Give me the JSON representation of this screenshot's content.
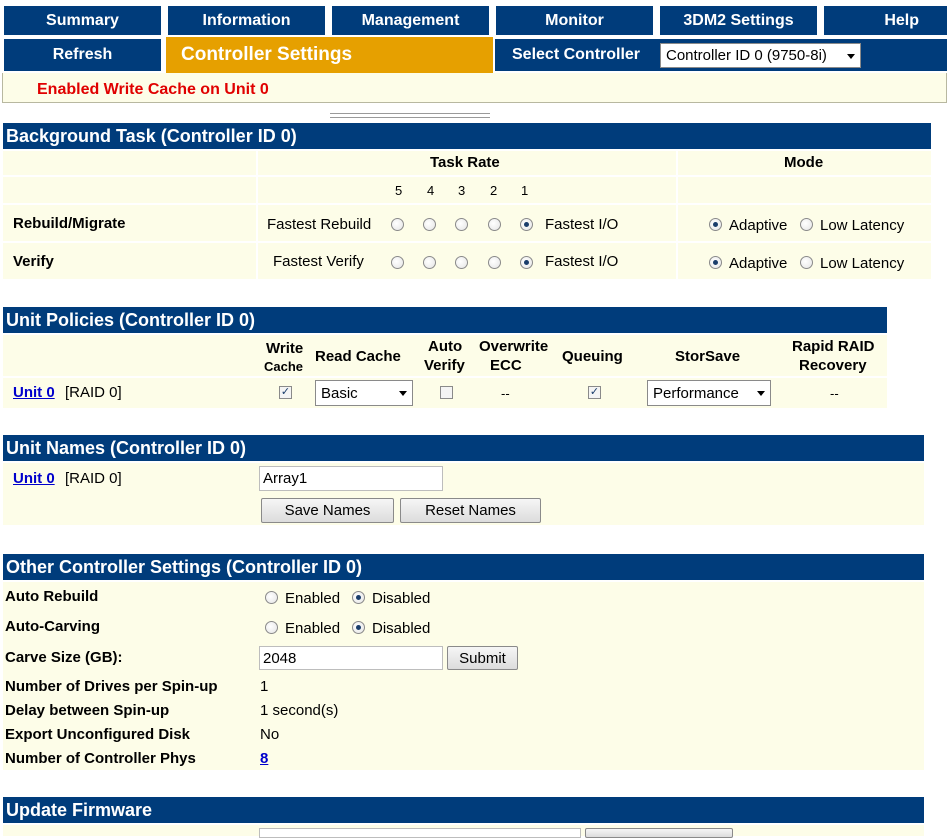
{
  "nav": {
    "summary": "Summary",
    "information": "Information",
    "management": "Management",
    "monitor": "Monitor",
    "settings": "3DM2 Settings",
    "help": "Help",
    "refresh": "Refresh",
    "active": "Controller Settings",
    "select_label": "Select Controller",
    "select_value": "Controller ID 0 (9750-8i)"
  },
  "message": "Enabled Write Cache on Unit 0",
  "background": {
    "title": "Background Task (Controller ID 0)",
    "task_rate": "Task Rate",
    "mode": "Mode",
    "rates": [
      "5",
      "4",
      "3",
      "2",
      "1"
    ],
    "rows": [
      {
        "label": "Rebuild/Migrate",
        "left": "Fastest Rebuild",
        "right": "Fastest I/O",
        "adaptive": "Adaptive",
        "low": "Low Latency"
      },
      {
        "label": "Verify",
        "left": "Fastest Verify",
        "right": "Fastest I/O",
        "adaptive": "Adaptive",
        "low": "Low Latency"
      }
    ]
  },
  "policies": {
    "title": "Unit Policies (Controller ID 0)",
    "h_write": "Write",
    "h_cache": "Cache",
    "h_read": "Read Cache",
    "h_auto1": "Auto",
    "h_auto2": "Verify",
    "h_over1": "Overwrite",
    "h_over2": "ECC",
    "h_queue": "Queuing",
    "h_storsave": "StorSave",
    "h_rapid1": "Rapid RAID",
    "h_rapid2": "Recovery",
    "unit": "Unit 0",
    "raid": "[RAID 0]",
    "read_value": "Basic",
    "overwrite_value": "--",
    "storsave_value": "Performance",
    "rapid_value": "--"
  },
  "names": {
    "title": "Unit Names (Controller ID 0)",
    "unit": "Unit 0",
    "raid": "[RAID 0]",
    "name_value": "Array1",
    "save": "Save Names",
    "reset": "Reset Names"
  },
  "other": {
    "title": "Other Controller Settings (Controller ID 0)",
    "enabled": "Enabled",
    "disabled": "Disabled",
    "auto_rebuild": "Auto Rebuild",
    "auto_carving": "Auto-Carving",
    "carve_size": "Carve Size (GB):",
    "carve_value": "2048",
    "submit": "Submit",
    "drives_label": "Number of Drives per Spin-up",
    "drives_value": "1",
    "delay_label": "Delay between Spin-up",
    "delay_value": "1 second(s)",
    "export_label": "Export Unconfigured Disk",
    "export_value": "No",
    "phys_label": "Number of Controller Phys",
    "phys_value": "8"
  },
  "firmware": {
    "title": "Update Firmware"
  }
}
